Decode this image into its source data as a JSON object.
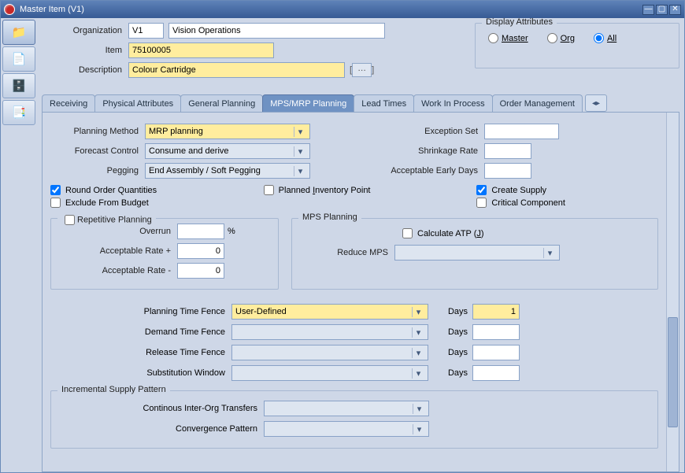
{
  "window": {
    "title": "Master Item (V1)"
  },
  "sidebar": {
    "items": [
      {
        "icon": "📁"
      },
      {
        "icon": "📄"
      },
      {
        "icon": "🗄️"
      },
      {
        "icon": "📑"
      }
    ]
  },
  "header": {
    "org_label": "Organization",
    "org_code": "V1",
    "org_name": "Vision Operations",
    "item_label": "Item",
    "item_value": "75100005",
    "desc_label": "Description",
    "desc_value": "Colour Cartridge",
    "ellipsis": "…"
  },
  "display_attributes": {
    "legend": "Display Attributes",
    "master": "Master",
    "org": "Org",
    "all": "All",
    "selected": "all"
  },
  "tabs": [
    "Receiving",
    "Physical Attributes",
    "General Planning",
    "MPS/MRP Planning",
    "Lead Times",
    "Work In Process",
    "Order Management"
  ],
  "tab_active_index": 3,
  "mps": {
    "planning_method_label": "Planning Method",
    "planning_method": "MRP planning",
    "forecast_label": "Forecast Control",
    "forecast": "Consume and derive",
    "pegging_label": "Pegging",
    "pegging": "End Assembly / Soft Pegging",
    "exception_label": "Exception Set",
    "exception": "",
    "shrinkage_label": "Shrinkage Rate",
    "shrinkage": "",
    "early_label": "Acceptable Early Days",
    "early": "",
    "round_label": "Round Order Quantities",
    "pip_label": "Planned Inventory Point",
    "create_label": "Create Supply",
    "exclude_label": "Exclude From Budget",
    "critical_label": "Critical Component"
  },
  "repetitive": {
    "legend": "Repetitive Planning",
    "overrun_label": "Overrun",
    "overrun": "",
    "pct": "%",
    "rate_plus_label": "Acceptable Rate +",
    "rate_plus": "0",
    "rate_minus_label": "Acceptable Rate -",
    "rate_minus": "0"
  },
  "mpsplan": {
    "legend": "MPS Planning",
    "calc_label": "Calculate ATP (J)",
    "reduce_label": "Reduce MPS",
    "reduce": ""
  },
  "timefence": {
    "ptf_label": "Planning Time Fence",
    "ptf": "User-Defined",
    "days_label": "Days",
    "ptf_days": "1",
    "dtf_label": "Demand Time Fence",
    "dtf": "",
    "dtf_days": "",
    "rtf_label": "Release Time Fence",
    "rtf": "",
    "rtf_days": "",
    "sub_label": "Substitution Window",
    "sub": "",
    "sub_days": ""
  },
  "isp": {
    "legend": "Incremental Supply Pattern",
    "cit_label": "Continous Inter-Org Transfers",
    "cit": "",
    "conv_label": "Convergence Pattern",
    "conv": ""
  }
}
